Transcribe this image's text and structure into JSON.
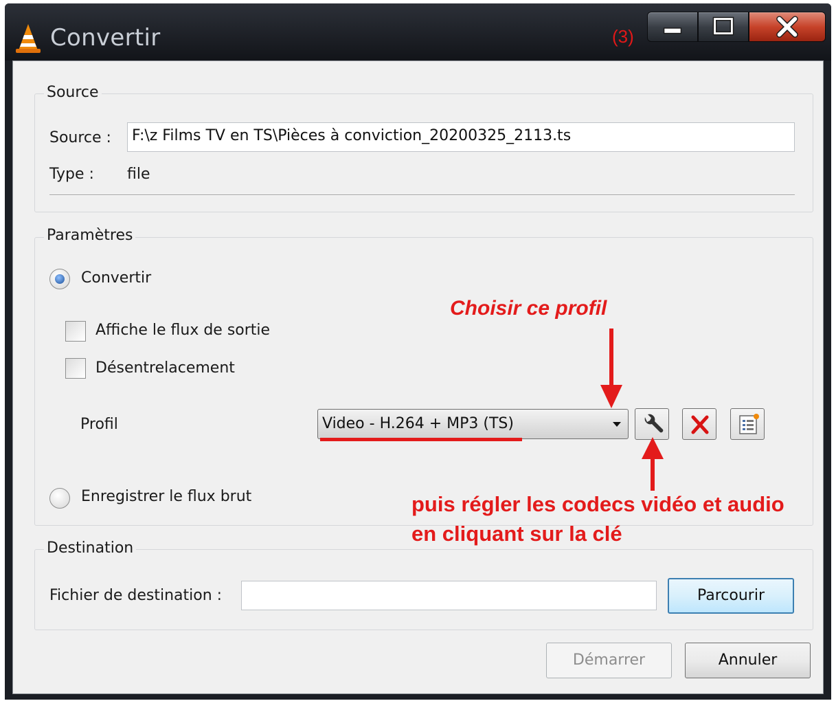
{
  "window": {
    "title": "Convertir",
    "step_mark": "(3)",
    "buttons": {
      "minimize": "minimize",
      "maximize": "maximize",
      "close": "close"
    }
  },
  "source_group": {
    "title": "Source",
    "source_label": "Source :",
    "source_value": "F:\\z  Films TV en TS\\Pièces à conviction_20200325_2113.ts",
    "type_label": "Type :",
    "type_value": "file"
  },
  "params_group": {
    "title": "Paramètres",
    "convert_radio": {
      "label": "Convertir",
      "selected": true
    },
    "show_output_checkbox": {
      "label": "Affiche le flux de sortie",
      "checked": false
    },
    "deinterlace_checkbox": {
      "label": "Désentrelacement",
      "checked": false
    },
    "profile_label": "Profil",
    "profile_value": "Video - H.264 + MP3 (TS)",
    "raw_dump_radio": {
      "label": "Enregistrer le flux brut",
      "selected": false
    }
  },
  "destination_group": {
    "title": "Destination",
    "file_label": "Fichier de destination :",
    "file_value": "",
    "browse_label": "Parcourir"
  },
  "footer": {
    "start_label": "Démarrer",
    "cancel_label": "Annuler"
  },
  "annotations": {
    "choose_profile": "Choisir ce profil",
    "codec_line1": "puis régler  les codecs vidéo  et audio",
    "codec_line2": "en cliquant sur la clé",
    "color": "#e31b1b"
  },
  "icons": {
    "app": "vlc-cone-icon",
    "edit_profile": "wrench-icon",
    "delete_profile": "red-x-icon",
    "new_profile": "new-profile-list-icon"
  }
}
